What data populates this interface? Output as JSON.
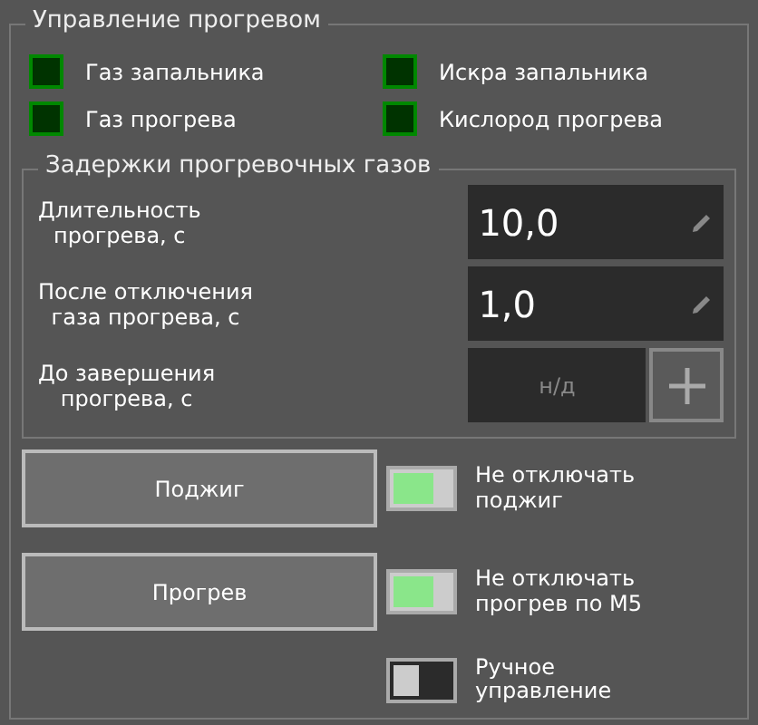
{
  "heating_control": {
    "title": "Управление прогревом",
    "indicators": [
      {
        "label": "Газ запальника",
        "on": false
      },
      {
        "label": "Искра запальника",
        "on": false
      },
      {
        "label": "Газ прогрева",
        "on": false
      },
      {
        "label": "Кислород прогрева",
        "on": false
      }
    ],
    "gas_delays": {
      "title": "Задержки прогревочных газов",
      "fields": [
        {
          "kind": "editable",
          "label": "Длительность\nпрогрева, с",
          "value": "10,0"
        },
        {
          "kind": "editable",
          "label": "После отключения\nгаза прогрева, с",
          "value": "1,0"
        },
        {
          "kind": "readonly",
          "label": "До завершения\nпрогрева, с",
          "value": "н/д"
        }
      ]
    },
    "buttons": [
      "Поджиг",
      "Прогрев"
    ],
    "toggles": [
      {
        "label": "Не отключать\nподжиг",
        "on": true
      },
      {
        "label": "Не отключать\nпрогрев по М5",
        "on": true
      },
      {
        "label": "Ручное\nуправление",
        "on": false
      }
    ]
  }
}
